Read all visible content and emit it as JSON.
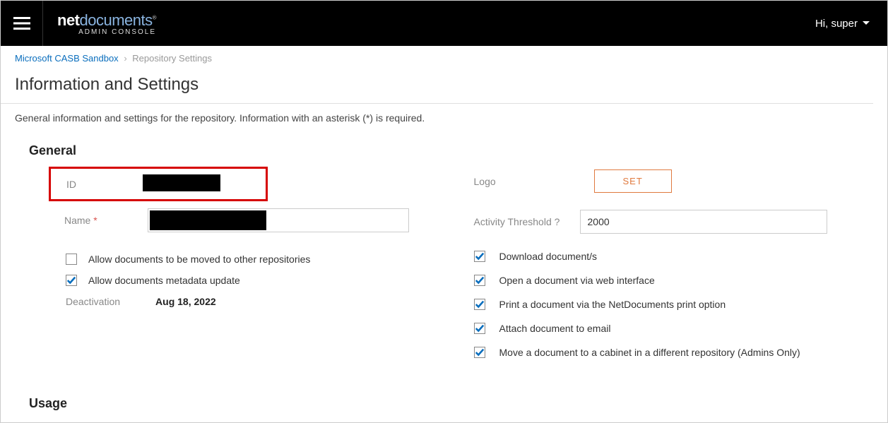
{
  "header": {
    "logo_bold": "net",
    "logo_light": "documents",
    "logo_sup": "®",
    "logo_sub": "ADMIN CONSOLE",
    "greeting": "Hi, super"
  },
  "breadcrumb": {
    "link": "Microsoft CASB Sandbox",
    "current": "Repository Settings"
  },
  "page": {
    "title": "Information and Settings",
    "description": "General information and settings for the repository. Information with an asterisk (*) is required."
  },
  "section": {
    "general_heading": "General",
    "usage_heading": "Usage"
  },
  "general": {
    "id_label": "ID",
    "id_value": "",
    "name_label": "Name",
    "name_value": "",
    "allow_move_label": "Allow documents to be moved to other repositories",
    "allow_move_checked": false,
    "allow_metadata_label": "Allow documents metadata update",
    "allow_metadata_checked": true,
    "deactivation_label": "Deactivation",
    "deactivation_value": "Aug 18, 2022"
  },
  "right": {
    "logo_label": "Logo",
    "set_button": "SET",
    "threshold_label": "Activity Threshold ?",
    "threshold_value": "2000"
  },
  "permissions": [
    {
      "label": "Download document/s",
      "checked": true
    },
    {
      "label": "Open a document via web interface",
      "checked": true
    },
    {
      "label": "Print a document via the NetDocuments print option",
      "checked": true
    },
    {
      "label": "Attach document to email",
      "checked": true
    },
    {
      "label": "Move a document to a cabinet in a different repository (Admins Only)",
      "checked": true
    }
  ]
}
